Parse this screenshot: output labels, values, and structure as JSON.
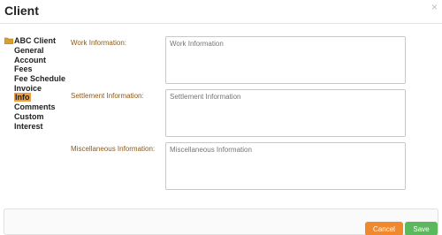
{
  "dialog": {
    "title": "Client",
    "close_glyph": "×"
  },
  "tree": {
    "root_label": "ABC Client",
    "items": [
      {
        "label": "General"
      },
      {
        "label": "Account"
      },
      {
        "label": "Fees"
      },
      {
        "label": "Fee Schedule"
      },
      {
        "label": "Invoice"
      },
      {
        "label": "Info",
        "selected": true
      },
      {
        "label": "Comments"
      },
      {
        "label": "Custom"
      },
      {
        "label": "Interest"
      }
    ]
  },
  "fields": {
    "work": {
      "label": "Work Information:",
      "placeholder": "Work Information"
    },
    "settlement": {
      "label": "Settlement Information:",
      "placeholder": "Settlement Information"
    },
    "misc": {
      "label": "Miscellaneous Information:",
      "placeholder": "Miscellaneous Information"
    }
  },
  "footer": {
    "cancel_label": "Cancel",
    "save_label": "Save"
  },
  "colors": {
    "accent_orange": "#f0882e",
    "save_green": "#5cb85c",
    "label_brown": "#8a5a1e",
    "selected_bg": "#f0a040"
  },
  "icons": {
    "folder": "folder-icon",
    "close": "close-icon"
  }
}
